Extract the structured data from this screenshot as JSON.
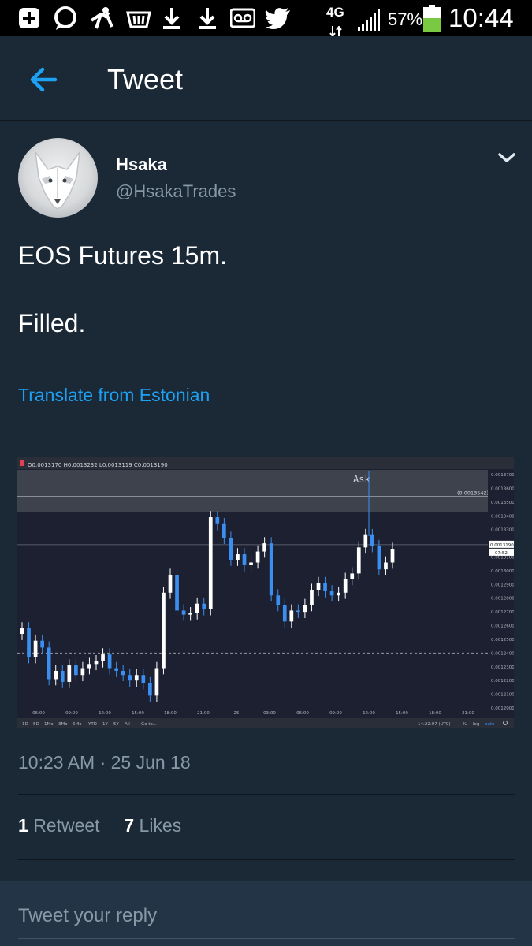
{
  "status_bar": {
    "network": "4G",
    "battery": "57%",
    "time": "10:44",
    "icons": [
      "add-icon",
      "chat-icon",
      "runner-icon",
      "basket-icon",
      "download-icon",
      "download-icon",
      "voicemail-icon",
      "twitter-icon",
      "data-arrows-icon",
      "signal-icon",
      "battery-icon"
    ]
  },
  "header": {
    "title": "Tweet",
    "back_icon": "arrow-left-icon",
    "accent": "#1da1f2"
  },
  "tweet": {
    "author_name": "Hsaka",
    "author_handle": "@HsakaTrades",
    "menu_icon": "chevron-down-icon",
    "text_line1": "EOS Futures 15m.",
    "text_line2": "Filled.",
    "translate": "Translate from Estonian",
    "timestamp": "10:23 AM · 25 Jun 18",
    "retweets_count": "1",
    "retweets_label": "Retweet",
    "likes_count": "7",
    "likes_label": "Likes"
  },
  "reply": {
    "placeholder": "Tweet your reply"
  },
  "chart_data": {
    "type": "candlestick",
    "ohlc_header": "O0.0013170  H0.0013232  L0.0013119  C0.0013190",
    "zone_label": "Ask",
    "zone_value": "(0.0013542)",
    "price_label": "0.0013190",
    "countdown": "07:52",
    "ylim": [
      0.0012,
      0.0013735
    ],
    "y_ticks": [
      "0.0013700",
      "0.0013600",
      "0.0013500",
      "0.0013400",
      "0.0013300",
      "0.0013200",
      "0.0013100",
      "0.0013000",
      "0.0012900",
      "0.0012800",
      "0.0012700",
      "0.0012600",
      "0.0012500",
      "0.0012400",
      "0.0012300",
      "0.0012200",
      "0.0012100",
      "0.0012000"
    ],
    "x_ticks": [
      "06:00",
      "09:00",
      "12:00",
      "15:00",
      "18:00",
      "21:00",
      "25",
      "03:00",
      "06:00",
      "09:00",
      "12:00",
      "15:00",
      "18:00",
      "21:00"
    ],
    "ask_zone": [
      0.001343,
      0.0013735
    ],
    "ask_line": 0.0013542,
    "current_price": 0.001319,
    "dashed_level": 0.00124,
    "bottom_bar": [
      "1D",
      "5D",
      "1Mo",
      "3Mo",
      "6Mo",
      "YTD",
      "1Y",
      "5Y",
      "All",
      "Go to..."
    ],
    "bottom_right": [
      "14:22:07 (UTC)",
      "%",
      "log",
      "auto"
    ],
    "close_series": [
      0.001258,
      0.001237,
      0.001249,
      0.001244,
      0.001221,
      0.001227,
      0.001219,
      0.001231,
      0.001224,
      0.001229,
      0.001232,
      0.001234,
      0.001239,
      0.001229,
      0.001227,
      0.001224,
      0.00122,
      0.001224,
      0.001218,
      0.001209,
      0.001229,
      0.001284,
      0.001297,
      0.001271,
      0.001268,
      0.001269,
      0.001276,
      0.001272,
      0.001339,
      0.001334,
      0.001324,
      0.001308,
      0.001312,
      0.001304,
      0.001306,
      0.001314,
      0.00132,
      0.001282,
      0.001275,
      0.001263,
      0.001271,
      0.00127,
      0.001275,
      0.001286,
      0.001291,
      0.001285,
      0.001282,
      0.001284,
      0.001294,
      0.001298,
      0.001317,
      0.001326,
      0.001318,
      0.001301,
      0.001306,
      0.001316
    ]
  }
}
